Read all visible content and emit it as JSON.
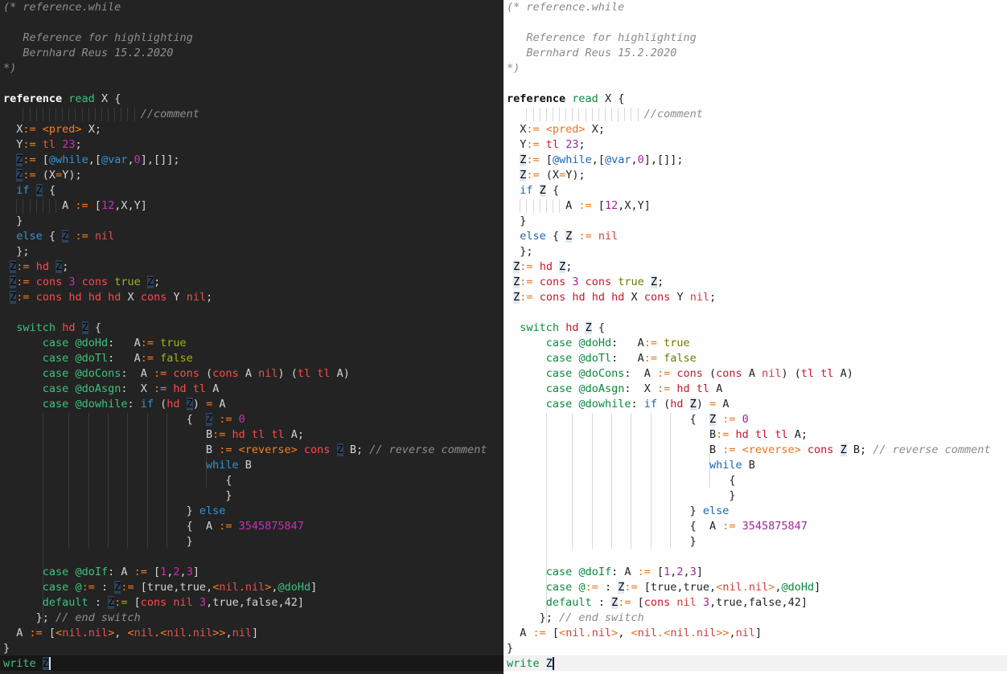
{
  "editors": [
    {
      "theme": "dark",
      "colors": {
        "background": "#232323",
        "current_line": "#171717"
      }
    },
    {
      "theme": "light",
      "colors": {
        "background": "#fefefe",
        "current_line": "#f2f2f2"
      }
    }
  ],
  "lines": [
    [
      [
        "c",
        "(* reference.while"
      ]
    ],
    [],
    [
      [
        "c",
        "   Reference for highlighting"
      ]
    ],
    [
      [
        "c",
        "   Bernhard Reus 15.2.2020"
      ]
    ],
    [
      [
        "c",
        "*)"
      ]
    ],
    [],
    [
      [
        "kw",
        "reference"
      ],
      [
        "d",
        " "
      ],
      [
        "g",
        "read"
      ],
      [
        "d",
        " X {"
      ]
    ],
    [
      [
        "d",
        "                     "
      ],
      [
        "c",
        "//comment"
      ]
    ],
    [
      [
        "d",
        "  X"
      ],
      [
        "o",
        ":="
      ],
      [
        "d",
        " "
      ],
      [
        "o",
        "<pred>"
      ],
      [
        "d",
        " X;"
      ]
    ],
    [
      [
        "d",
        "  Y"
      ],
      [
        "o",
        ":="
      ],
      [
        "d",
        " "
      ],
      [
        "r",
        "tl"
      ],
      [
        "d",
        " "
      ],
      [
        "m",
        "23"
      ],
      [
        "d",
        ";"
      ]
    ],
    [
      [
        "d",
        "  "
      ],
      [
        "hl",
        "Z"
      ],
      [
        "o",
        ":="
      ],
      [
        "d",
        " ["
      ],
      [
        "b",
        "@while"
      ],
      [
        "d",
        ",["
      ],
      [
        "b",
        "@var"
      ],
      [
        "d",
        ","
      ],
      [
        "m",
        "0"
      ],
      [
        "d",
        "],[]];"
      ]
    ],
    [
      [
        "d",
        "  "
      ],
      [
        "hl",
        "Z"
      ],
      [
        "o",
        ":="
      ],
      [
        "d",
        " (X"
      ],
      [
        "o",
        "="
      ],
      [
        "d",
        "Y);"
      ]
    ],
    [
      [
        "d",
        "  "
      ],
      [
        "b",
        "if"
      ],
      [
        "d",
        " "
      ],
      [
        "hl",
        "Z"
      ],
      [
        "d",
        " {"
      ]
    ],
    [
      [
        "d",
        "         A "
      ],
      [
        "o",
        ":="
      ],
      [
        "d",
        " ["
      ],
      [
        "m",
        "12"
      ],
      [
        "d",
        ",X,Y]"
      ]
    ],
    [
      [
        "d",
        "  }"
      ]
    ],
    [
      [
        "d",
        "  "
      ],
      [
        "b",
        "else"
      ],
      [
        "d",
        " { "
      ],
      [
        "hl",
        "Z"
      ],
      [
        "d",
        " "
      ],
      [
        "o",
        ":="
      ],
      [
        "d",
        " "
      ],
      [
        "x",
        "nil"
      ]
    ],
    [
      [
        "d",
        "  };"
      ]
    ],
    [
      [
        "d",
        " "
      ],
      [
        "hl",
        "Z"
      ],
      [
        "o",
        ":="
      ],
      [
        "d",
        " "
      ],
      [
        "r",
        "hd"
      ],
      [
        "d",
        " "
      ],
      [
        "hl",
        "Z"
      ],
      [
        "d",
        ";"
      ]
    ],
    [
      [
        "d",
        " "
      ],
      [
        "hl",
        "Z"
      ],
      [
        "o",
        ":="
      ],
      [
        "d",
        " "
      ],
      [
        "r",
        "cons"
      ],
      [
        "d",
        " "
      ],
      [
        "m",
        "3"
      ],
      [
        "d",
        " "
      ],
      [
        "r",
        "cons"
      ],
      [
        "d",
        " "
      ],
      [
        "y",
        "true"
      ],
      [
        "d",
        " "
      ],
      [
        "hl",
        "Z"
      ],
      [
        "d",
        ";"
      ]
    ],
    [
      [
        "d",
        " "
      ],
      [
        "hl",
        "Z"
      ],
      [
        "o",
        ":="
      ],
      [
        "d",
        " "
      ],
      [
        "r",
        "cons"
      ],
      [
        "d",
        " "
      ],
      [
        "r",
        "hd"
      ],
      [
        "d",
        " "
      ],
      [
        "r",
        "hd"
      ],
      [
        "d",
        " "
      ],
      [
        "r",
        "hd"
      ],
      [
        "d",
        " X "
      ],
      [
        "r",
        "cons"
      ],
      [
        "d",
        " Y "
      ],
      [
        "x",
        "nil"
      ],
      [
        "d",
        ";"
      ]
    ],
    [],
    [
      [
        "d",
        "  "
      ],
      [
        "g",
        "switch"
      ],
      [
        "d",
        " "
      ],
      [
        "r",
        "hd"
      ],
      [
        "d",
        " "
      ],
      [
        "hl",
        "Z"
      ],
      [
        "d",
        " {"
      ]
    ],
    [
      [
        "d",
        "      "
      ],
      [
        "g",
        "case"
      ],
      [
        "d",
        " "
      ],
      [
        "g",
        "@doHd"
      ],
      [
        "d",
        ":   A"
      ],
      [
        "o",
        ":="
      ],
      [
        "d",
        " "
      ],
      [
        "y",
        "true"
      ]
    ],
    [
      [
        "d",
        "      "
      ],
      [
        "g",
        "case"
      ],
      [
        "d",
        " "
      ],
      [
        "g",
        "@doTl"
      ],
      [
        "d",
        ":   A"
      ],
      [
        "o",
        ":="
      ],
      [
        "d",
        " "
      ],
      [
        "y",
        "false"
      ]
    ],
    [
      [
        "d",
        "      "
      ],
      [
        "g",
        "case"
      ],
      [
        "d",
        " "
      ],
      [
        "g",
        "@doCons"
      ],
      [
        "d",
        ":  A "
      ],
      [
        "o",
        ":="
      ],
      [
        "d",
        " "
      ],
      [
        "r",
        "cons"
      ],
      [
        "d",
        " ("
      ],
      [
        "r",
        "cons"
      ],
      [
        "d",
        " A "
      ],
      [
        "x",
        "nil"
      ],
      [
        "d",
        ") ("
      ],
      [
        "r",
        "tl"
      ],
      [
        "d",
        " "
      ],
      [
        "r",
        "tl"
      ],
      [
        "d",
        " A)"
      ]
    ],
    [
      [
        "d",
        "      "
      ],
      [
        "g",
        "case"
      ],
      [
        "d",
        " "
      ],
      [
        "g",
        "@doAsgn"
      ],
      [
        "d",
        ":  X "
      ],
      [
        "o",
        ":="
      ],
      [
        "d",
        " "
      ],
      [
        "r",
        "hd"
      ],
      [
        "d",
        " "
      ],
      [
        "r",
        "tl"
      ],
      [
        "d",
        " A"
      ]
    ],
    [
      [
        "d",
        "      "
      ],
      [
        "g",
        "case"
      ],
      [
        "d",
        " "
      ],
      [
        "g",
        "@dowhile"
      ],
      [
        "d",
        ": "
      ],
      [
        "b",
        "if"
      ],
      [
        "d",
        " ("
      ],
      [
        "r",
        "hd"
      ],
      [
        "d",
        " "
      ],
      [
        "hl",
        "Z"
      ],
      [
        "d",
        ") "
      ],
      [
        "o",
        "="
      ],
      [
        "d",
        " A"
      ]
    ],
    [
      [
        "d",
        "                            {  "
      ],
      [
        "hl",
        "Z"
      ],
      [
        "d",
        " "
      ],
      [
        "o",
        ":="
      ],
      [
        "d",
        " "
      ],
      [
        "m",
        "0"
      ]
    ],
    [
      [
        "d",
        "                               B"
      ],
      [
        "o",
        ":="
      ],
      [
        "d",
        " "
      ],
      [
        "r",
        "hd"
      ],
      [
        "d",
        " "
      ],
      [
        "r",
        "tl"
      ],
      [
        "d",
        " "
      ],
      [
        "r",
        "tl"
      ],
      [
        "d",
        " A;"
      ]
    ],
    [
      [
        "d",
        "                               B "
      ],
      [
        "o",
        ":="
      ],
      [
        "d",
        " "
      ],
      [
        "o",
        "<reverse>"
      ],
      [
        "d",
        " "
      ],
      [
        "r",
        "cons"
      ],
      [
        "d",
        " "
      ],
      [
        "hl",
        "Z"
      ],
      [
        "d",
        " B; "
      ],
      [
        "c",
        "// reverse comment"
      ]
    ],
    [
      [
        "d",
        "                               "
      ],
      [
        "b",
        "while"
      ],
      [
        "d",
        " B"
      ]
    ],
    [
      [
        "d",
        "                                  {"
      ]
    ],
    [
      [
        "d",
        "                                  }"
      ]
    ],
    [
      [
        "d",
        "                            } "
      ],
      [
        "b",
        "else"
      ]
    ],
    [
      [
        "d",
        "                            {  A "
      ],
      [
        "o",
        ":="
      ],
      [
        "d",
        " "
      ],
      [
        "m",
        "3545875847"
      ]
    ],
    [
      [
        "d",
        "                            }"
      ]
    ],
    [],
    [
      [
        "d",
        "      "
      ],
      [
        "g",
        "case"
      ],
      [
        "d",
        " "
      ],
      [
        "g",
        "@doIf"
      ],
      [
        "d",
        ": A "
      ],
      [
        "o",
        ":="
      ],
      [
        "d",
        " ["
      ],
      [
        "m",
        "1"
      ],
      [
        "d",
        ","
      ],
      [
        "m",
        "2"
      ],
      [
        "d",
        ","
      ],
      [
        "m",
        "3"
      ],
      [
        "d",
        "]"
      ]
    ],
    [
      [
        "d",
        "      "
      ],
      [
        "g",
        "case"
      ],
      [
        "d",
        " "
      ],
      [
        "g",
        "@"
      ],
      [
        "o",
        ":="
      ],
      [
        "d",
        " : "
      ],
      [
        "hl",
        "Z"
      ],
      [
        "o",
        ":="
      ],
      [
        "d",
        " [true,true,"
      ],
      [
        "o",
        "<"
      ],
      [
        "x",
        "nil"
      ],
      [
        "o",
        "."
      ],
      [
        "x",
        "nil"
      ],
      [
        "o",
        ">"
      ],
      [
        "d",
        ","
      ],
      [
        "g",
        "@doHd"
      ],
      [
        "d",
        "]"
      ]
    ],
    [
      [
        "d",
        "      "
      ],
      [
        "g",
        "default"
      ],
      [
        "d",
        " : "
      ],
      [
        "hl",
        "Z"
      ],
      [
        "o",
        ":="
      ],
      [
        "d",
        " ["
      ],
      [
        "r",
        "cons"
      ],
      [
        "d",
        " "
      ],
      [
        "x",
        "nil"
      ],
      [
        "d",
        " "
      ],
      [
        "m",
        "3"
      ],
      [
        "d",
        ",true,false,42]"
      ]
    ],
    [
      [
        "d",
        "     }; "
      ],
      [
        "c",
        "// end switch"
      ]
    ],
    [
      [
        "d",
        "  A "
      ],
      [
        "o",
        ":="
      ],
      [
        "d",
        " ["
      ],
      [
        "o",
        "<"
      ],
      [
        "x",
        "nil"
      ],
      [
        "o",
        "."
      ],
      [
        "x",
        "nil"
      ],
      [
        "o",
        ">"
      ],
      [
        "d",
        ", "
      ],
      [
        "o",
        "<"
      ],
      [
        "x",
        "nil"
      ],
      [
        "o",
        "."
      ],
      [
        "o",
        "<"
      ],
      [
        "x",
        "nil"
      ],
      [
        "o",
        "."
      ],
      [
        "x",
        "nil"
      ],
      [
        "o",
        ">>"
      ],
      [
        "d",
        ","
      ],
      [
        "x",
        "nil"
      ],
      [
        "d",
        "]"
      ]
    ],
    [
      [
        "d",
        "}"
      ]
    ],
    [
      [
        "g",
        "write"
      ],
      [
        "d",
        " "
      ],
      [
        "hl",
        "Z"
      ]
    ]
  ]
}
